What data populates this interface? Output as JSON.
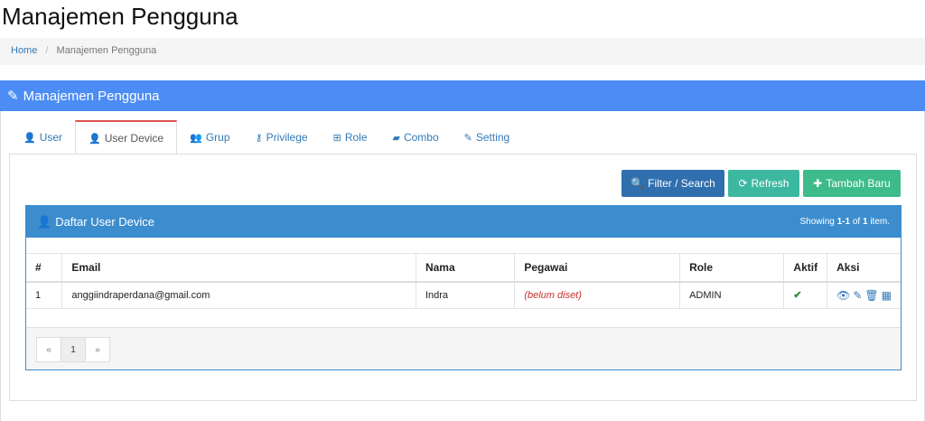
{
  "page": {
    "title": "Manajemen Pengguna"
  },
  "breadcrumb": {
    "home": "Home",
    "separator": "/",
    "current": "Manajemen Pengguna"
  },
  "panel": {
    "title": "Manajemen Pengguna",
    "icon": "pencil-icon"
  },
  "tabs": [
    {
      "label": "User",
      "icon": "user-icon"
    },
    {
      "label": "User Device",
      "icon": "user-icon",
      "active": true
    },
    {
      "label": "Grup",
      "icon": "users-icon"
    },
    {
      "label": "Privilege",
      "icon": "key-icon"
    },
    {
      "label": "Role",
      "icon": "sitemap-icon"
    },
    {
      "label": "Combo",
      "icon": "book-icon"
    },
    {
      "label": "Setting",
      "icon": "edit-icon"
    }
  ],
  "toolbar": {
    "filter_label": "Filter / Search",
    "refresh_label": "Refresh",
    "add_label": "Tambah Baru"
  },
  "grid": {
    "title": "Daftar User Device",
    "summary_prefix": "Showing",
    "summary_range": "1-1",
    "summary_of": "of",
    "summary_total": "1",
    "summary_suffix": "item.",
    "columns": [
      "#",
      "Email",
      "Nama",
      "Pegawai",
      "Role",
      "Aktif",
      "Aksi"
    ],
    "rows": [
      {
        "no": "1",
        "email": "anggiindraperdana@gmail.com",
        "nama": "Indra",
        "pegawai": "(belum diset)",
        "role": "ADMIN",
        "aktif": "✔"
      }
    ],
    "pager": {
      "prev": "«",
      "page": "1",
      "next": "»"
    }
  },
  "colors": {
    "panel_heading": "#4c8df5",
    "grid_heading": "#3c8dce",
    "filter_btn": "#2f6fae",
    "refresh_btn": "#3cb8a0",
    "add_btn": "#3dbb8a",
    "active_tab_border": "#d9534f"
  }
}
